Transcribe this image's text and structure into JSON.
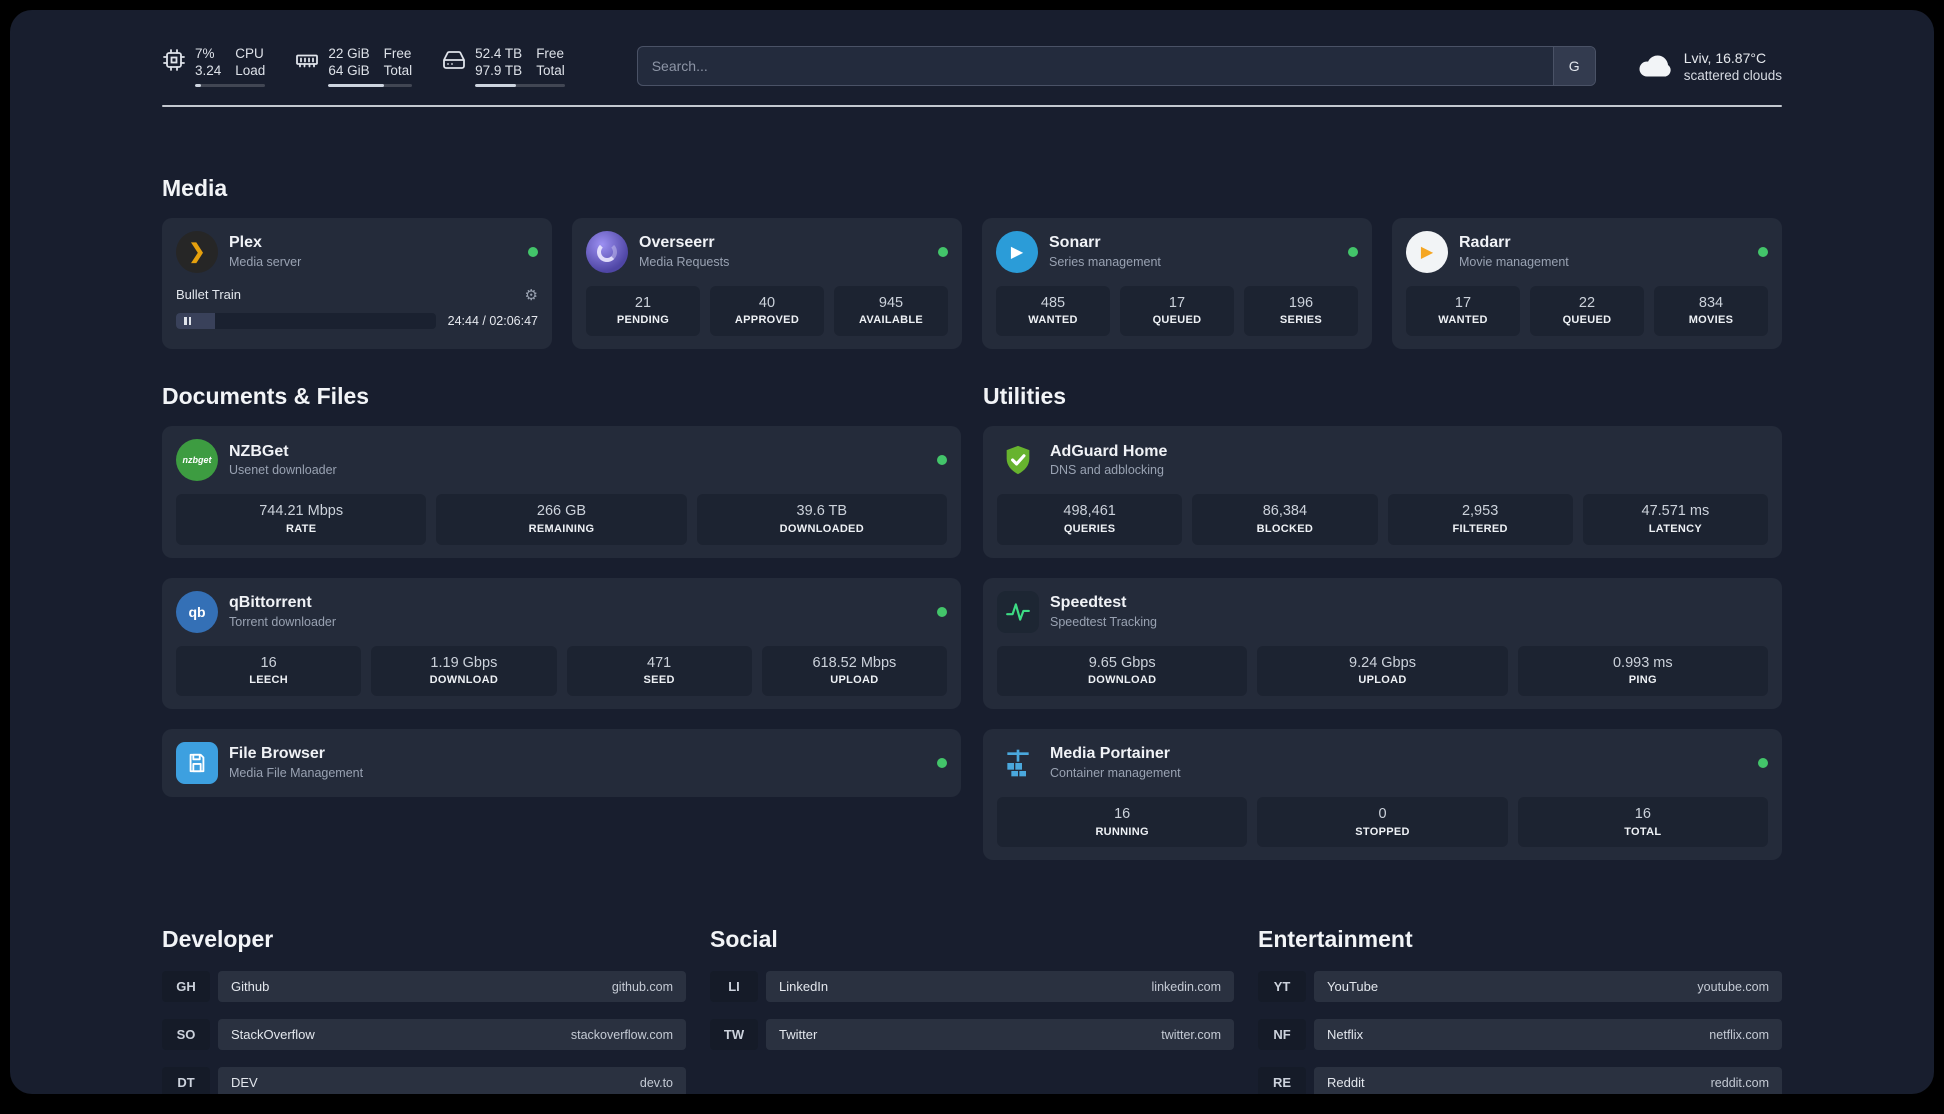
{
  "topbar": {
    "cpu": {
      "percent": "7%",
      "load": "3.24",
      "label_top": "CPU",
      "label_bottom": "Load"
    },
    "memory": {
      "free": "22 GiB",
      "total": "64 GiB",
      "label_top": "Free",
      "label_bottom": "Total"
    },
    "disk": {
      "free": "52.4 TB",
      "total": "97.9 TB",
      "label_top": "Free",
      "label_bottom": "Total"
    },
    "search": {
      "placeholder": "Search...",
      "button": "G"
    },
    "weather": {
      "location": "Lviv, 16.87°C",
      "condition": "scattered clouds"
    }
  },
  "media": {
    "title": "Media",
    "plex": {
      "name": "Plex",
      "subtitle": "Media server",
      "icon_glyph": "❯",
      "now_playing": "Bullet Train",
      "gear": "⚙",
      "time": "24:44 / 02:06:47"
    },
    "overseerr": {
      "name": "Overseerr",
      "subtitle": "Media Requests",
      "stats": [
        {
          "value": "21",
          "label": "PENDING"
        },
        {
          "value": "40",
          "label": "APPROVED"
        },
        {
          "value": "945",
          "label": "AVAILABLE"
        }
      ]
    },
    "sonarr": {
      "name": "Sonarr",
      "subtitle": "Series management",
      "icon_glyph": "▶",
      "stats": [
        {
          "value": "485",
          "label": "WANTED"
        },
        {
          "value": "17",
          "label": "QUEUED"
        },
        {
          "value": "196",
          "label": "SERIES"
        }
      ]
    },
    "radarr": {
      "name": "Radarr",
      "subtitle": "Movie management",
      "icon_glyph": "▶",
      "stats": [
        {
          "value": "17",
          "label": "WANTED"
        },
        {
          "value": "22",
          "label": "QUEUED"
        },
        {
          "value": "834",
          "label": "MOVIES"
        }
      ]
    }
  },
  "documents": {
    "title": "Documents & Files",
    "nzbget": {
      "name": "NZBGet",
      "subtitle": "Usenet downloader",
      "icon_text": "nzbget",
      "stats": [
        {
          "value": "744.21 Mbps",
          "label": "RATE"
        },
        {
          "value": "266 GB",
          "label": "REMAINING"
        },
        {
          "value": "39.6 TB",
          "label": "DOWNLOADED"
        }
      ]
    },
    "qbittorrent": {
      "name": "qBittorrent",
      "subtitle": "Torrent downloader",
      "icon_text": "qb",
      "stats": [
        {
          "value": "16",
          "label": "LEECH"
        },
        {
          "value": "1.19 Gbps",
          "label": "DOWNLOAD"
        },
        {
          "value": "471",
          "label": "SEED"
        },
        {
          "value": "618.52 Mbps",
          "label": "UPLOAD"
        }
      ]
    },
    "filebrowser": {
      "name": "File Browser",
      "subtitle": "Media File Management"
    }
  },
  "utilities": {
    "title": "Utilities",
    "adguard": {
      "name": "AdGuard Home",
      "subtitle": "DNS and adblocking",
      "stats": [
        {
          "value": "498,461",
          "label": "QUERIES"
        },
        {
          "value": "86,384",
          "label": "BLOCKED"
        },
        {
          "value": "2,953",
          "label": "FILTERED"
        },
        {
          "value": "47.571 ms",
          "label": "LATENCY"
        }
      ]
    },
    "speedtest": {
      "name": "Speedtest",
      "subtitle": "Speedtest Tracking",
      "stats": [
        {
          "value": "9.65 Gbps",
          "label": "DOWNLOAD"
        },
        {
          "value": "9.24 Gbps",
          "label": "UPLOAD"
        },
        {
          "value": "0.993 ms",
          "label": "PING"
        }
      ]
    },
    "portainer": {
      "name": "Media Portainer",
      "subtitle": "Container management",
      "stats": [
        {
          "value": "16",
          "label": "RUNNING"
        },
        {
          "value": "0",
          "label": "STOPPED"
        },
        {
          "value": "16",
          "label": "TOTAL"
        }
      ]
    }
  },
  "bookmarks": {
    "developer": {
      "title": "Developer",
      "items": [
        {
          "abbr": "GH",
          "label": "Github",
          "url": "github.com"
        },
        {
          "abbr": "SO",
          "label": "StackOverflow",
          "url": "stackoverflow.com"
        },
        {
          "abbr": "DT",
          "label": "DEV",
          "url": "dev.to"
        }
      ]
    },
    "social": {
      "title": "Social",
      "items": [
        {
          "abbr": "LI",
          "label": "LinkedIn",
          "url": "linkedin.com"
        },
        {
          "abbr": "TW",
          "label": "Twitter",
          "url": "twitter.com"
        }
      ]
    },
    "entertainment": {
      "title": "Entertainment",
      "items": [
        {
          "abbr": "YT",
          "label": "YouTube",
          "url": "youtube.com"
        },
        {
          "abbr": "NF",
          "label": "Netflix",
          "url": "netflix.com"
        },
        {
          "abbr": "RE",
          "label": "Reddit",
          "url": "reddit.com"
        }
      ]
    }
  }
}
